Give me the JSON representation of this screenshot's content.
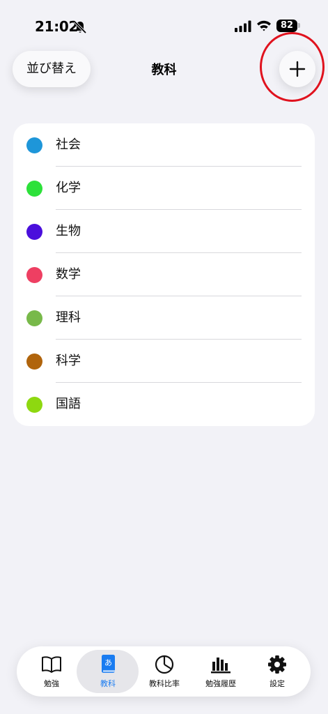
{
  "status_bar": {
    "time": "21:02",
    "battery": "82"
  },
  "header": {
    "sort_label": "並び替え",
    "title": "教科"
  },
  "subjects": [
    {
      "label": "社会",
      "color": "#1e96d9"
    },
    {
      "label": "化学",
      "color": "#2de13a"
    },
    {
      "label": "生物",
      "color": "#4a0fdc"
    },
    {
      "label": "数学",
      "color": "#ee3f62"
    },
    {
      "label": "理科",
      "color": "#78b94a"
    },
    {
      "label": "科学",
      "color": "#b0640c"
    },
    {
      "label": "国語",
      "color": "#8ed810"
    }
  ],
  "tabs": [
    {
      "label": "勉強",
      "icon": "book-icon"
    },
    {
      "label": "教科",
      "icon": "textbook-icon",
      "active": true
    },
    {
      "label": "教科比率",
      "icon": "pie-chart-icon"
    },
    {
      "label": "勉強履歴",
      "icon": "bar-chart-icon"
    },
    {
      "label": "設定",
      "icon": "gear-icon"
    }
  ],
  "colors": {
    "accent": "#1a7cf1",
    "highlight_ring": "#e0121e"
  }
}
